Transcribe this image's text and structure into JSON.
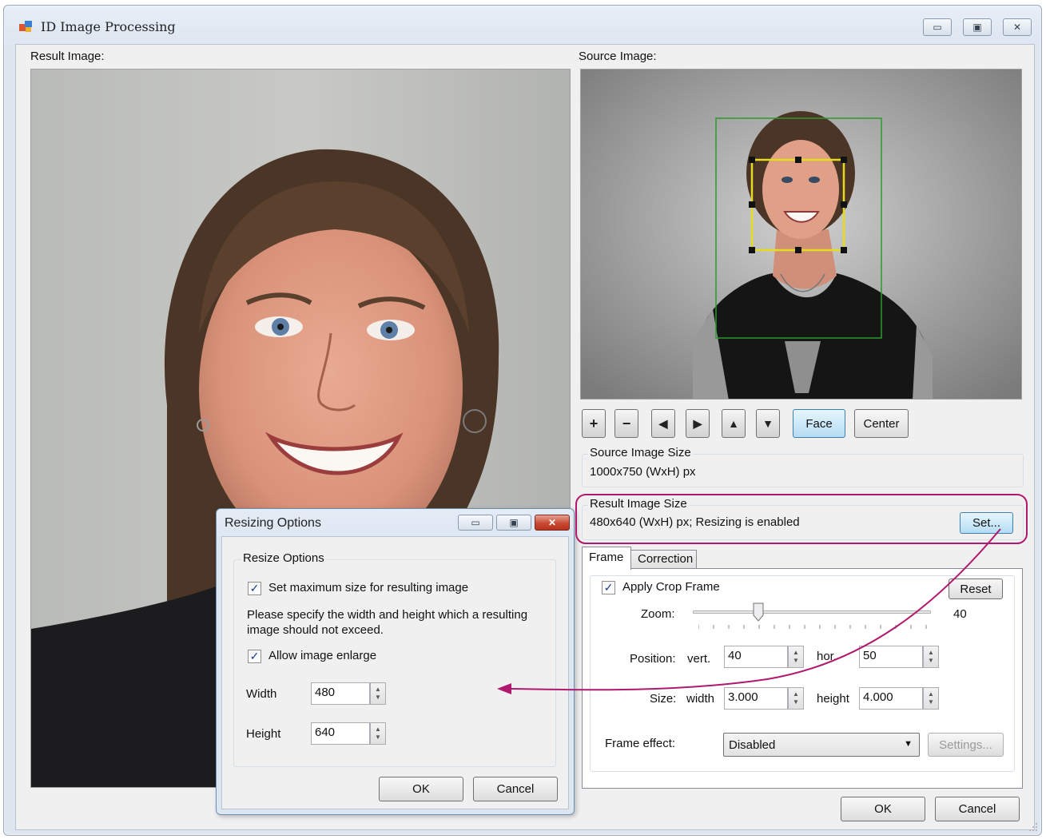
{
  "window": {
    "title": "ID Image Processing",
    "minimize": "▭",
    "maximize": "▣",
    "close": "✕"
  },
  "labels": {
    "result_image": "Result Image:",
    "source_image": "Source Image:"
  },
  "toolbar": {
    "zoom_in": "+",
    "zoom_out": "−",
    "left": "◀",
    "right": "▶",
    "up": "▲",
    "down": "▼",
    "face": "Face",
    "center": "Center"
  },
  "source_size": {
    "title": "Source Image Size",
    "value": "1000x750 (WxH) px"
  },
  "result_size": {
    "title": "Result Image Size",
    "value": "480x640 (WxH) px; Resizing is enabled",
    "set_button": "Set..."
  },
  "tabs": [
    "Frame",
    "Correction"
  ],
  "frame": {
    "apply_crop": "Apply Crop Frame",
    "apply_crop_checked": true,
    "reset": "Reset",
    "zoom_label": "Zoom:",
    "zoom_value": "40",
    "zoom_level": 0.4,
    "position_label": "Position:",
    "vert_label": "vert.",
    "vert_value": "40",
    "hor_label": "hor.",
    "hor_value": "50",
    "size_label": "Size:",
    "width_label": "width",
    "width_value": "3.000",
    "height_label": "height",
    "height_value": "4.000",
    "effect_label": "Frame effect:",
    "effect_value": "Disabled",
    "settings": "Settings..."
  },
  "buttons": {
    "ok": "OK",
    "cancel": "Cancel"
  },
  "dialog": {
    "title": "Resizing Options",
    "group_title": "Resize Options",
    "set_max": "Set maximum size for resulting image",
    "set_max_checked": true,
    "description": "Please specify the width and height which a resulting image should not exceed.",
    "allow_enlarge": "Allow image enlarge",
    "allow_enlarge_checked": true,
    "width_label": "Width",
    "width_value": "480",
    "height_label": "Height",
    "height_value": "640",
    "ok": "OK",
    "cancel": "Cancel"
  },
  "colors": {
    "highlight": "#b0196e",
    "face_frame": "#e6dc1e",
    "crop_frame": "#2c9a2c"
  }
}
